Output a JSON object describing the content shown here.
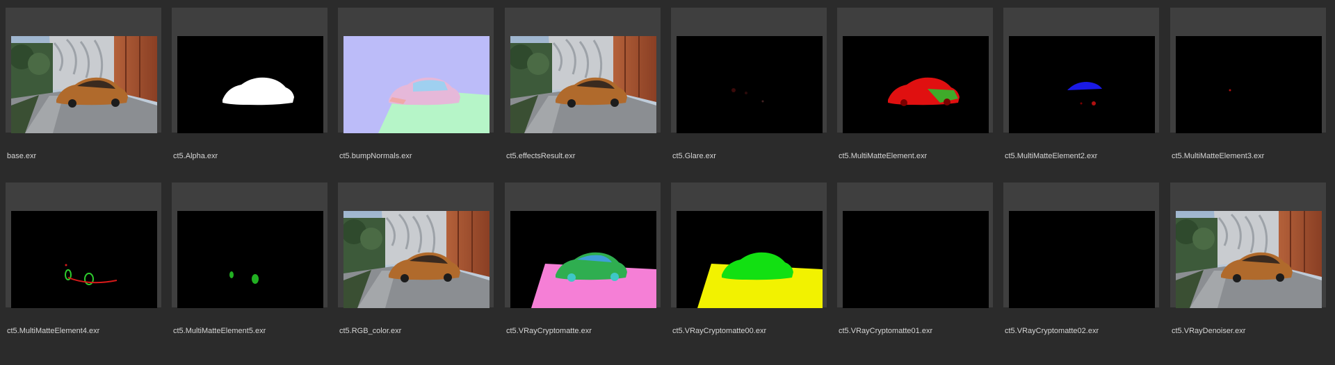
{
  "files": [
    {
      "name": "base.exr",
      "kind": "photo"
    },
    {
      "name": "ct5.Alpha.exr",
      "kind": "alpha"
    },
    {
      "name": "ct5.bumpNormals.exr",
      "kind": "normals"
    },
    {
      "name": "ct5.effectsResult.exr",
      "kind": "photo"
    },
    {
      "name": "ct5.Glare.exr",
      "kind": "glare"
    },
    {
      "name": "ct5.MultiMatteElement.exr",
      "kind": "matte1"
    },
    {
      "name": "ct5.MultiMatteElement2.exr",
      "kind": "matte2"
    },
    {
      "name": "ct5.MultiMatteElement3.exr",
      "kind": "matte3"
    },
    {
      "name": "ct5.MultiMatteElement4.exr",
      "kind": "matte4"
    },
    {
      "name": "ct5.MultiMatteElement5.exr",
      "kind": "matte5"
    },
    {
      "name": "ct5.RGB_color.exr",
      "kind": "photo"
    },
    {
      "name": "ct5.VRayCryptomatte.exr",
      "kind": "crypto"
    },
    {
      "name": "ct5.VRayCryptomatte00.exr",
      "kind": "crypto00"
    },
    {
      "name": "ct5.VRayCryptomatte01.exr",
      "kind": "black"
    },
    {
      "name": "ct5.VRayCryptomatte02.exr",
      "kind": "black"
    },
    {
      "name": "ct5.VRayDenoiser.exr",
      "kind": "photo"
    }
  ],
  "colors": {
    "background": "#2b2b2b",
    "card": "#3f3f3f",
    "label": "#d6d6d6"
  }
}
